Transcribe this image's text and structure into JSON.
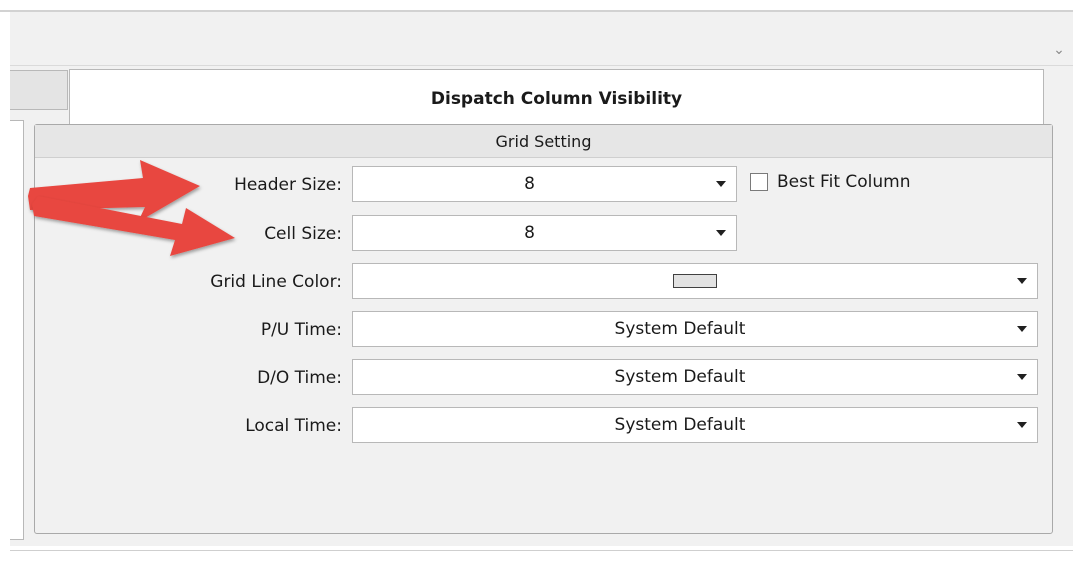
{
  "window": {
    "tab_title": "Dispatch Column Visibility"
  },
  "grid_setting": {
    "title": "Grid Setting",
    "header_size": {
      "label": "Header Size:",
      "value": "8"
    },
    "best_fit": {
      "label": "Best Fit Column",
      "checked": false
    },
    "cell_size": {
      "label": "Cell Size:",
      "value": "8"
    },
    "grid_line_color": {
      "label": "Grid Line Color:",
      "swatch_color": "#e2e2e2"
    },
    "pu_time": {
      "label": "P/U Time:",
      "value": "System Default"
    },
    "do_time": {
      "label": "D/O Time:",
      "value": "System Default"
    },
    "local_time": {
      "label": "Local Time:",
      "value": "System Default"
    }
  },
  "icons": {
    "collapse": "chevron-down-icon",
    "dropdown": "dropdown-arrow-icon",
    "annotation": "red-arrow-icon"
  },
  "colors": {
    "annotation_arrow": "#e8473f"
  }
}
